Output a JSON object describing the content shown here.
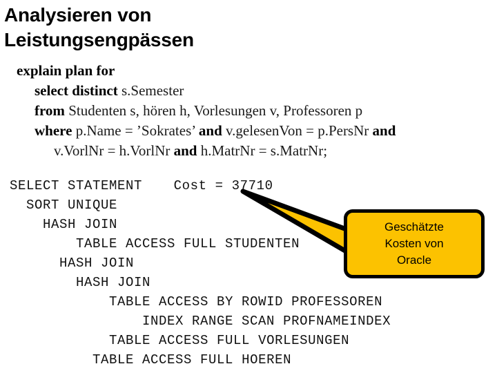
{
  "slide": {
    "background_color": "#ffffff",
    "title_lines": [
      "Analysieren von",
      "Leistungsengpässen"
    ]
  },
  "sql": {
    "lines": [
      {
        "indent": 0,
        "parts": [
          {
            "text": "explain plan for",
            "bold": true
          }
        ]
      },
      {
        "indent": 1,
        "parts": [
          {
            "text": "select distinct ",
            "bold": true
          },
          {
            "text": "s.Semester",
            "bold": false
          }
        ]
      },
      {
        "indent": 1,
        "parts": [
          {
            "text": "from ",
            "bold": true
          },
          {
            "text": "Studenten s, hören h, Vorlesungen v, Professoren p",
            "bold": false
          }
        ]
      },
      {
        "indent": 1,
        "parts": [
          {
            "text": "where ",
            "bold": true
          },
          {
            "text": "p.Name = ’Sokrates’ ",
            "bold": false
          },
          {
            "text": "and ",
            "bold": true
          },
          {
            "text": "v.gelesenVon = p.PersNr ",
            "bold": false
          },
          {
            "text": "and",
            "bold": true
          }
        ]
      },
      {
        "indent": 2,
        "parts": [
          {
            "text": "v.VorlNr = h.VorlNr ",
            "bold": false
          },
          {
            "text": "and ",
            "bold": true
          },
          {
            "text": "h.MatrNr = s.MatrNr;",
            "bold": false
          }
        ]
      }
    ]
  },
  "plan": {
    "lines": [
      {
        "indent": 0,
        "operation": "SELECT STATEMENT",
        "cost_label": "Cost = 37710"
      },
      {
        "indent": 1,
        "operation": "SORT UNIQUE",
        "cost_label": ""
      },
      {
        "indent": 2,
        "operation": "HASH JOIN",
        "cost_label": ""
      },
      {
        "indent": 4,
        "operation": "TABLE ACCESS FULL STUDENTEN",
        "cost_label": ""
      },
      {
        "indent": 3,
        "operation": "HASH JOIN",
        "cost_label": ""
      },
      {
        "indent": 4,
        "operation": "HASH JOIN",
        "cost_label": ""
      },
      {
        "indent": 6,
        "operation": "TABLE ACCESS BY ROWID PROFESSOREN",
        "cost_label": ""
      },
      {
        "indent": 8,
        "operation": "INDEX RANGE SCAN PROFNAMEINDEX",
        "cost_label": ""
      },
      {
        "indent": 6,
        "operation": "TABLE ACCESS FULL VORLESUNGEN",
        "cost_label": ""
      },
      {
        "indent": 5,
        "operation": "TABLE ACCESS FULL HOEREN",
        "cost_label": ""
      }
    ]
  },
  "callout": {
    "fill_color": "#FCC200",
    "border_color": "#000000",
    "text_lines": [
      "Geschätzte",
      "Kosten von",
      "Oracle"
    ]
  }
}
